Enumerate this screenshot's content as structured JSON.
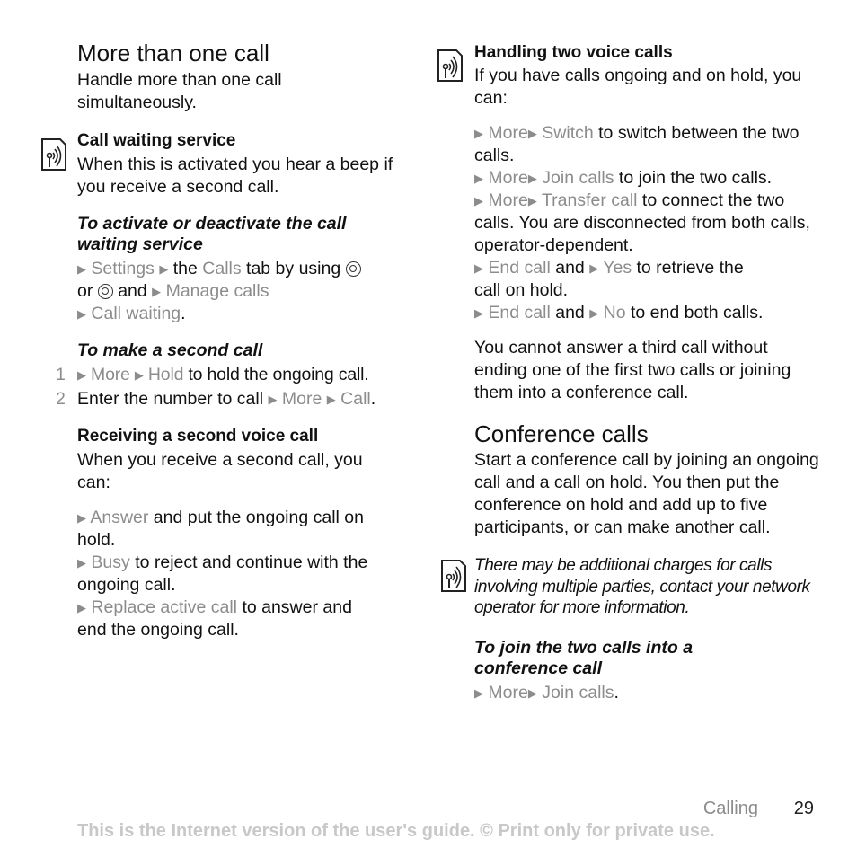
{
  "left": {
    "title": "More than one call",
    "intro": "Handle more than one call simultaneously.",
    "call_waiting": {
      "heading": "Call waiting service",
      "text": "When this is activated you hear a beep if you receive a second call."
    },
    "activate": {
      "heading": "To activate or deactivate the call waiting service",
      "settings": "Settings",
      "the": "the",
      "calls": "Calls",
      "tab_by_using": "tab by using",
      "or": "or",
      "and": "and",
      "manage_calls": "Manage calls",
      "call_waiting": "Call waiting",
      "period": "."
    },
    "second_call": {
      "heading": "To make a second call",
      "steps": [
        {
          "num": "1",
          "more": "More",
          "hold": "Hold",
          "text": "to hold the ongoing call."
        },
        {
          "num": "2",
          "text": "Enter the number to call",
          "more": "More",
          "call": "Call",
          "period": "."
        }
      ]
    },
    "receiving": {
      "heading": "Receiving a second voice call",
      "text": "When you receive a second call, you can:",
      "options": [
        {
          "label": "Answer",
          "text": "and put the ongoing call on hold."
        },
        {
          "label": "Busy",
          "text": "to reject and continue with the ongoing call."
        },
        {
          "label": "Replace active call",
          "text": "to answer and end the ongoing call."
        }
      ]
    }
  },
  "right": {
    "handling": {
      "heading": "Handling two voice calls",
      "text": "If you have calls ongoing and on hold, you can:",
      "more": "More",
      "and": "and",
      "options": [
        {
          "label": "Switch",
          "text": "to switch between the two calls."
        },
        {
          "label": "Join calls",
          "text": "to join the two calls."
        },
        {
          "label": "Transfer call",
          "text": "to connect the two calls. You are disconnected from both calls, operator-dependent."
        },
        {
          "label": "End call",
          "label2": "Yes",
          "text": "to retrieve the call on hold."
        },
        {
          "label": "End call",
          "label2": "No",
          "text": "to end both calls."
        }
      ]
    },
    "third_call": "You cannot answer a third call without ending one of the first two calls or joining them into a conference call.",
    "conference": {
      "title": "Conference calls",
      "text": "Start a conference call by joining an ongoing call and a call on hold. You then put the conference on hold and add up to five participants, or can make another call.",
      "note": "There may be additional charges for calls involving multiple parties, contact your network operator for more information.",
      "join_heading": "To join the two calls into a conference call",
      "more": "More",
      "join_calls": "Join calls",
      "period": "."
    }
  },
  "footer": {
    "section": "Calling",
    "page": "29",
    "notice": "This is the Internet version of the user's guide. © Print only for private use."
  },
  "icons": {
    "arrow": "▶"
  }
}
